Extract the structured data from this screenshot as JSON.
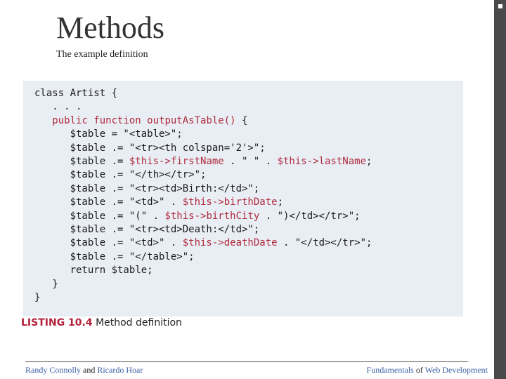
{
  "slide": {
    "title": "Methods",
    "subtitle": "The example definition"
  },
  "listing": {
    "code_lines": [
      "class Artist {",
      "   . . .",
      "   public function outputAsTable() {",
      "      $table = \"<table>\";",
      "      $table .= \"<tr><th colspan='2'>\";",
      "      $table .= $this->firstName . \" \" . $this->lastName;",
      "      $table .= \"</th></tr>\";",
      "      $table .= \"<tr><td>Birth:</td>\";",
      "      $table .= \"<td>\" . $this->birthDate;",
      "      $table .= \"(\" . $this->birthCity . \")</td></tr>\";",
      "      $table .= \"<tr><td>Death:</td>\";",
      "      $table .= \"<td>\" . $this->deathDate . \"</td></tr>\";",
      "      $table .= \"</table>\";",
      "      return $table;",
      "   }",
      "}"
    ],
    "caption_label": "LISTING 10.4",
    "caption_text": "Method definition"
  },
  "footer": {
    "author1": "Randy Connolly",
    "and_word": "and",
    "author2": "Ricardo Hoar",
    "book_word1": "Fundamentals",
    "book_word2": "of",
    "book_word3": "Web Development"
  },
  "colors": {
    "code_background": "#e9eef5",
    "keyword": "#b02b3c",
    "footer_link": "#3b5fa7",
    "right_bar": "#4a4a4a"
  }
}
